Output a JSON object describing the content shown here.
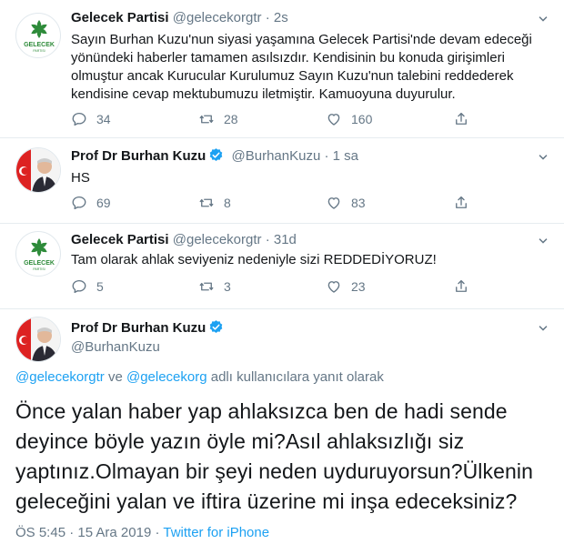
{
  "tweets": [
    {
      "name": "Gelecek Partisi",
      "handle": "@gelecekorgtr",
      "sep": "·",
      "time": "2s",
      "text": "Sayın Burhan Kuzu'nun siyasi yaşamına Gelecek Partisi'nde devam edeceği yönündeki haberler tamamen asılsızdır. Kendisinin bu konuda girişimleri olmuştur ancak Kurucular Kurulumuz Sayın Kuzu'nun talebini reddederek kendisine cevap mektubumuzu iletmiştir. Kamuoyuna duyurulur.",
      "replies": "34",
      "retweets": "28",
      "likes": "160",
      "avatar_label": "GELECEK",
      "avatar_sub": "PARTISI"
    },
    {
      "name": "Prof Dr Burhan Kuzu",
      "handle": "@BurhanKuzu",
      "sep": "·",
      "time": "1 sa",
      "text": "HS",
      "replies": "69",
      "retweets": "8",
      "likes": "83"
    },
    {
      "name": "Gelecek Partisi",
      "handle": "@gelecekorgtr",
      "sep": "·",
      "time": "31d",
      "text": "Tam olarak ahlak seviyeniz nedeniyle sizi REDDEDİYORUZ!",
      "replies": "5",
      "retweets": "3",
      "likes": "23",
      "avatar_label": "GELECEK",
      "avatar_sub": "PARTISI"
    }
  ],
  "main": {
    "name": "Prof Dr Burhan Kuzu",
    "handle": "@BurhanKuzu",
    "replying_handle1": "@gelecekorgtr",
    "replying_and": " ve ",
    "replying_handle2": "@gelecekorg",
    "replying_suffix": " adlı kullanıcılara yanıt olarak",
    "text": "Önce yalan haber yap ahlaksızca ben de hadi sende deyince böyle yazın öyle mi?Asıl ahlaksızlığı siz yaptınız.Olmayan bir şeyi neden uyduruyorsun?Ülkenin geleceğini yalan ve iftira üzerine mi inşa edeceksiniz?",
    "time": "ÖS 5:45",
    "sep1": " · ",
    "date": "15 Ara 2019",
    "sep2": " · ",
    "source": "Twitter for iPhone"
  },
  "colors": {
    "accent": "#1da1f2",
    "party_green": "#2e8b3a",
    "muted": "#657786",
    "text": "#14171a"
  },
  "icons": [
    "reply-icon",
    "retweet-icon",
    "like-icon",
    "share-icon",
    "verified-icon",
    "caret-down-icon"
  ]
}
